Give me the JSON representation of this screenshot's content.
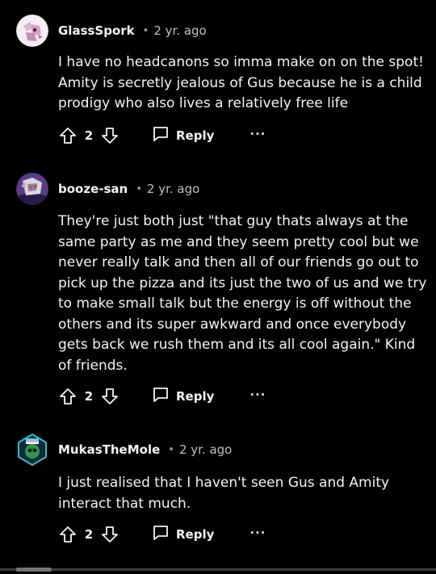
{
  "comments": [
    {
      "author": "GlassSpork",
      "separator": "•",
      "time": "2 yr. ago",
      "text": "I have no headcanons so imma make on on the spot! Amity is secretly jealous of Gus because he is a child prodigy who also lives a relatively free life",
      "votes": "2",
      "reply_label": "Reply",
      "more_label": "···",
      "avatar_colors": {
        "bg": "#f2eef2",
        "accent": "#d9a1c9",
        "dark": "#c48fb4"
      }
    },
    {
      "author": "booze-san",
      "separator": "•",
      "time": "2 yr. ago",
      "text": "They're just both just \"that guy thats always at the same party as me and they seem pretty cool but we never really talk and then all of our friends go out to pick up the pizza and its just the two of us and we try to make small talk but the energy is off without the others and its super awkward and once everybody gets back we rush them and its all cool again.\" Kind of friends.",
      "votes": "2",
      "reply_label": "Reply",
      "more_label": "···",
      "avatar_colors": {
        "bg": "#5a3a8a",
        "accent": "#d8d8e0",
        "dark": "#2a1a4a"
      }
    },
    {
      "author": "MukasTheMole",
      "separator": "•",
      "time": "2 yr. ago",
      "text": "I just realised that I haven't seen Gus and Amity interact that much.",
      "votes": "2",
      "reply_label": "Reply",
      "more_label": "···",
      "avatar_colors": {
        "bg": "#0f2a3a",
        "accent": "#3fb8c8",
        "dark": "#1e7a3a"
      }
    }
  ],
  "icons": {
    "upvote": "upvote-arrow-icon",
    "downvote": "downvote-arrow-icon",
    "reply": "speech-bubble-icon",
    "more": "ellipsis-icon"
  },
  "colors": {
    "background": "#000000",
    "text": "#f2f4f5",
    "meta": "#b8c1c6"
  }
}
